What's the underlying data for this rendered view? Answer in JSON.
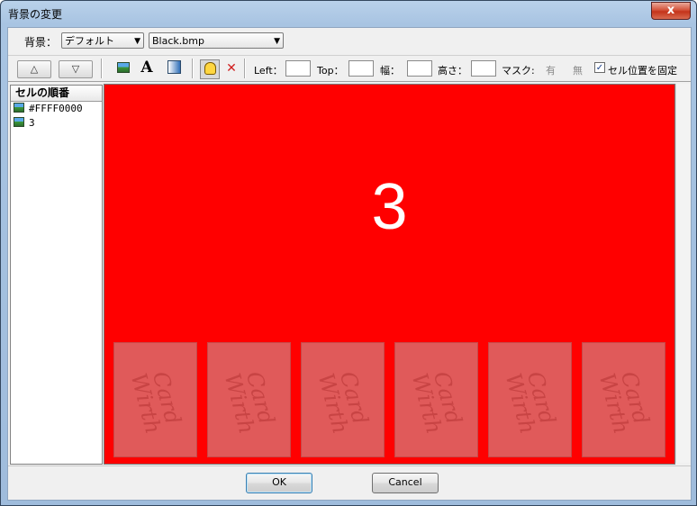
{
  "window": {
    "title": "背景の変更",
    "close_label": "x"
  },
  "background": {
    "label": "背景：",
    "type_value": "デフォルト",
    "file_value": "Black.bmp"
  },
  "toolbar": {
    "up_label": "△",
    "down_label": "▽",
    "left_label": "Left：",
    "top_label": "Top：",
    "width_label": "幅：",
    "height_label": "高さ：",
    "mask_label": "マスク:",
    "mask_on": "有",
    "mask_off": "無",
    "fix_label": "セル位置を固定",
    "fix_checked": true,
    "text_icon": "A"
  },
  "cells": {
    "header": "セルの順番",
    "items": [
      {
        "label": "#FFFF0000"
      },
      {
        "label": "3"
      }
    ]
  },
  "preview": {
    "background_color": "#FF0000",
    "cell_text": "3",
    "card_text": "Card Wirth"
  },
  "buttons": {
    "ok": "OK",
    "cancel": "Cancel"
  }
}
